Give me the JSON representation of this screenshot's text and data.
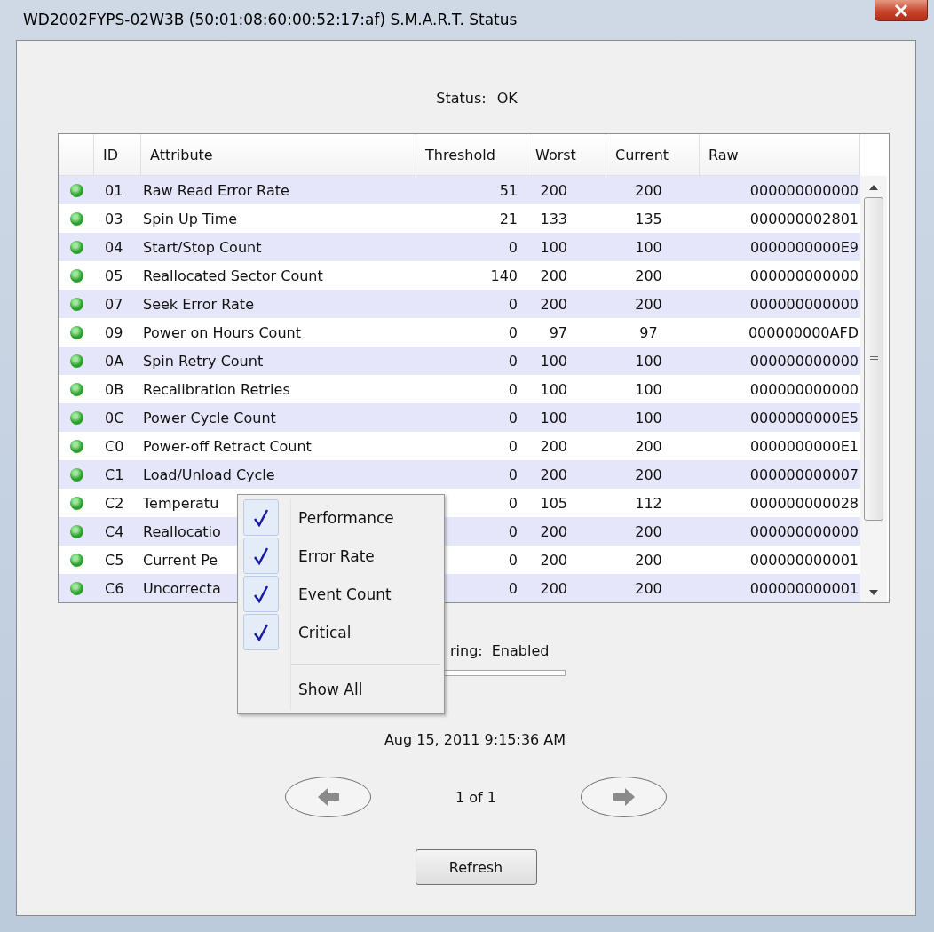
{
  "window": {
    "title": "WD2002FYPS-02W3B (50:01:08:60:00:52:17:af) S.M.A.R.T. Status"
  },
  "status": {
    "label": "Status:",
    "value": "OK"
  },
  "table": {
    "columns": [
      "ID",
      "Attribute",
      "Threshold",
      "Worst",
      "Current",
      "Raw"
    ],
    "rows": [
      {
        "color": "#2e9e2e",
        "id": "01",
        "attribute": "Raw Read Error Rate",
        "threshold": "51",
        "worst": "200",
        "current": "200",
        "raw": "000000000000"
      },
      {
        "color": "#2e9e2e",
        "id": "03",
        "attribute": "Spin Up Time",
        "threshold": "21",
        "worst": "133",
        "current": "135",
        "raw": "000000002801"
      },
      {
        "color": "#2e9e2e",
        "id": "04",
        "attribute": "Start/Stop Count",
        "threshold": "0",
        "worst": "100",
        "current": "100",
        "raw": "0000000000E9"
      },
      {
        "color": "#2e9e2e",
        "id": "05",
        "attribute": "Reallocated Sector Count",
        "threshold": "140",
        "worst": "200",
        "current": "200",
        "raw": "000000000000"
      },
      {
        "color": "#2e9e2e",
        "id": "07",
        "attribute": "Seek Error Rate",
        "threshold": "0",
        "worst": "200",
        "current": "200",
        "raw": "000000000000"
      },
      {
        "color": "#2e9e2e",
        "id": "09",
        "attribute": "Power on Hours Count",
        "threshold": "0",
        "worst": "97",
        "current": "97",
        "raw": "000000000AFD"
      },
      {
        "color": "#2e9e2e",
        "id": "0A",
        "attribute": "Spin Retry Count",
        "threshold": "0",
        "worst": "100",
        "current": "100",
        "raw": "000000000000"
      },
      {
        "color": "#2e9e2e",
        "id": "0B",
        "attribute": "Recalibration Retries",
        "threshold": "0",
        "worst": "100",
        "current": "100",
        "raw": "000000000000"
      },
      {
        "color": "#2e9e2e",
        "id": "0C",
        "attribute": "Power Cycle Count",
        "threshold": "0",
        "worst": "100",
        "current": "100",
        "raw": "0000000000E5"
      },
      {
        "color": "#2e9e2e",
        "id": "C0",
        "attribute": "Power-off Retract Count",
        "threshold": "0",
        "worst": "200",
        "current": "200",
        "raw": "0000000000E1"
      },
      {
        "color": "#2e9e2e",
        "id": "C1",
        "attribute": "Load/Unload Cycle",
        "threshold": "0",
        "worst": "200",
        "current": "200",
        "raw": "000000000007"
      },
      {
        "color": "#2e9e2e",
        "id": "C2",
        "attribute": "Temperatu",
        "threshold": "0",
        "worst": "105",
        "current": "112",
        "raw": "000000000028"
      },
      {
        "color": "#2e9e2e",
        "id": "C4",
        "attribute": "Reallocatio",
        "threshold": "0",
        "worst": "200",
        "current": "200",
        "raw": "000000000000"
      },
      {
        "color": "#2e9e2e",
        "id": "C5",
        "attribute": "Current Pe",
        "threshold": "0",
        "worst": "200",
        "current": "200",
        "raw": "000000000001"
      },
      {
        "color": "#2e9e2e",
        "id": "C6",
        "attribute": "Uncorrecta",
        "threshold": "0",
        "worst": "200",
        "current": "200",
        "raw": "000000000001"
      }
    ]
  },
  "context_menu": {
    "items": [
      {
        "kind": "toggle",
        "label": "Performance",
        "checked": true
      },
      {
        "kind": "toggle",
        "label": "Error Rate",
        "checked": true
      },
      {
        "kind": "toggle",
        "label": "Event Count",
        "checked": true
      },
      {
        "kind": "toggle",
        "label": "Critical",
        "checked": true
      },
      {
        "kind": "command",
        "label": "Show All"
      }
    ]
  },
  "monitoring": {
    "label": "ring:",
    "value": "Enabled"
  },
  "timestamp": "Aug 15, 2011 9:15:36 AM",
  "pager": {
    "text": "1 of 1"
  },
  "refresh_button": "Refresh"
}
